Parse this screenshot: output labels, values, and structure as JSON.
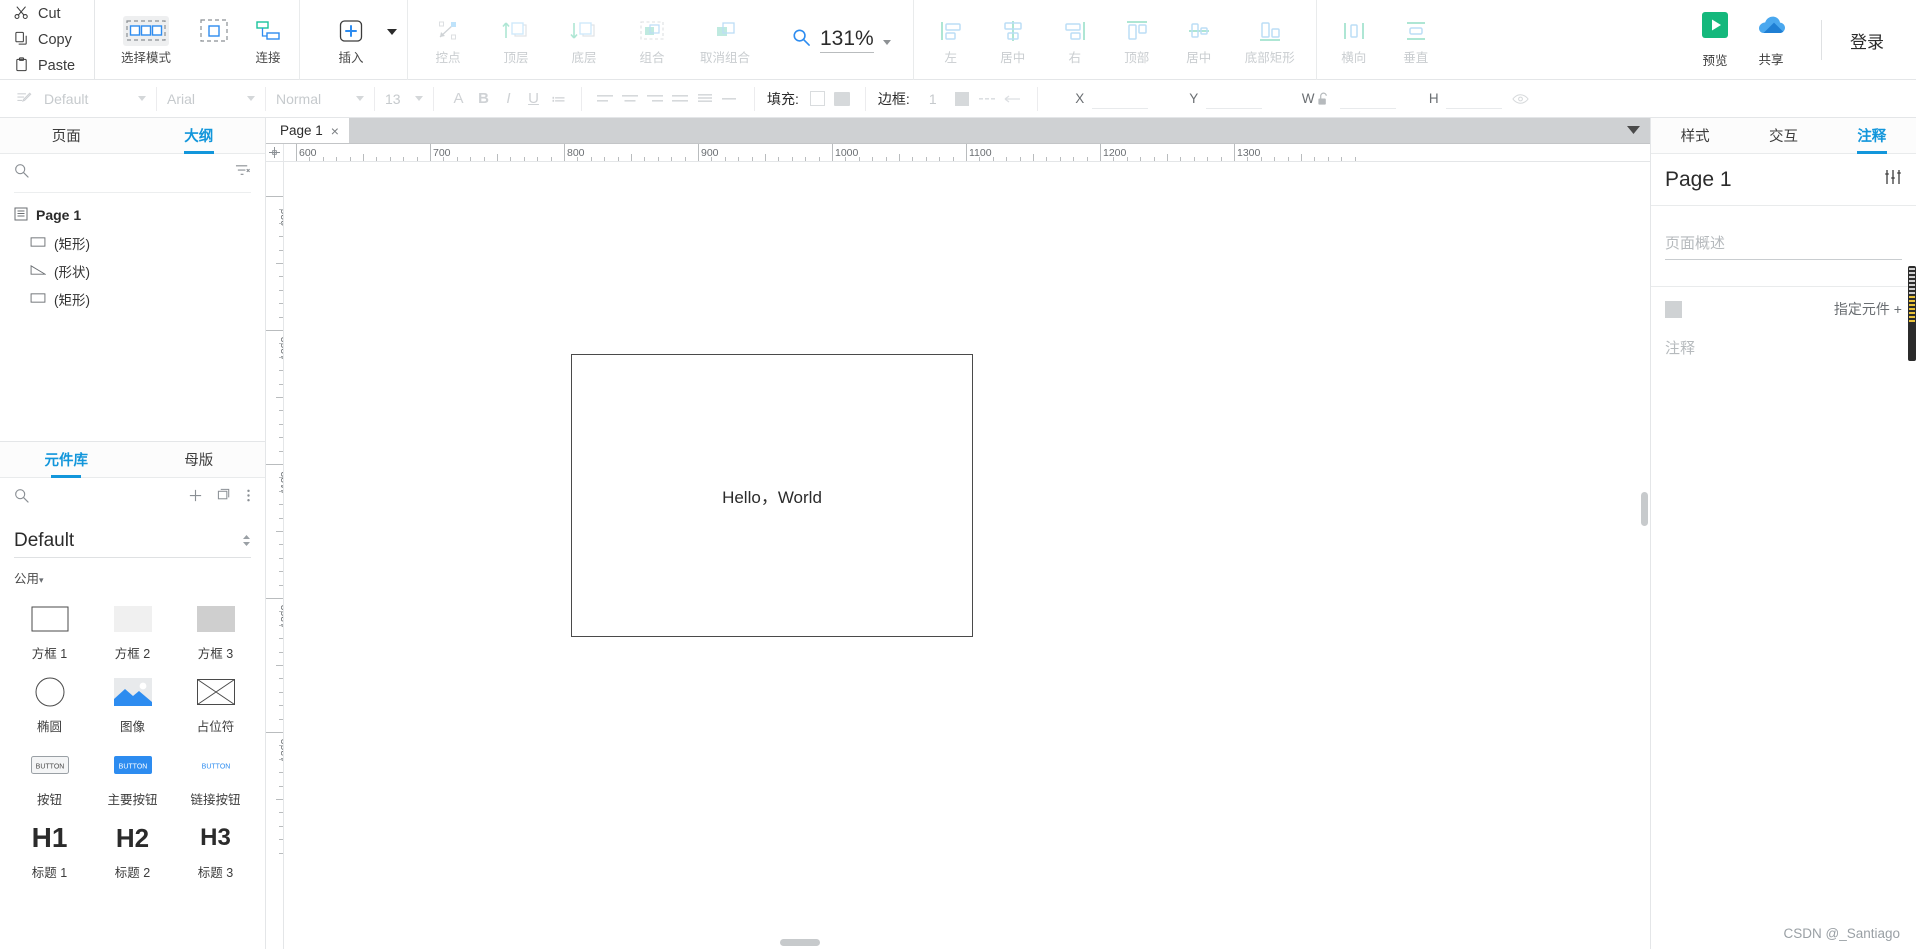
{
  "clipboard": {
    "items": [
      {
        "label": "Cut",
        "icon": "scissors-icon"
      },
      {
        "label": "Copy",
        "icon": "copy-icon"
      },
      {
        "label": "Paste",
        "icon": "clipboard-icon"
      }
    ]
  },
  "toolbar": {
    "mode_group": [
      {
        "label": "选择模式",
        "icon": "select-mode-icon",
        "state": "selected"
      },
      {
        "label": "连接",
        "icon": "connect-icon",
        "state": "enabled"
      }
    ],
    "insert": {
      "label": "插入",
      "icon": "plus-insert-icon"
    },
    "edit_group": [
      {
        "label": "控点",
        "icon": "control-point-icon",
        "state": "disabled"
      },
      {
        "label": "顶层",
        "icon": "bring-to-front-icon",
        "state": "disabled"
      },
      {
        "label": "底层",
        "icon": "send-to-back-icon",
        "state": "disabled"
      },
      {
        "label": "组合",
        "icon": "group-icon",
        "state": "disabled"
      },
      {
        "label": "取消组合",
        "icon": "ungroup-icon",
        "state": "disabled"
      }
    ],
    "zoom": {
      "value": "131%",
      "icon": "magnifier-icon",
      "caret": "chevron-down-icon"
    },
    "align_group": [
      {
        "label": "左",
        "icon": "align-left-icon",
        "state": "disabled"
      },
      {
        "label": "居中",
        "icon": "align-center-horizontal-icon",
        "state": "disabled"
      },
      {
        "label": "右",
        "icon": "align-right-icon",
        "state": "disabled"
      },
      {
        "label": "顶部",
        "icon": "align-top-icon",
        "state": "disabled"
      },
      {
        "label": "居中",
        "icon": "align-middle-vertical-icon",
        "state": "disabled"
      },
      {
        "label": "底部矩形",
        "icon": "align-bottom-icon",
        "state": "disabled"
      }
    ],
    "distribute_group": [
      {
        "label": "横向",
        "icon": "distribute-horizontal-icon",
        "state": "disabled"
      },
      {
        "label": "垂直",
        "icon": "distribute-vertical-icon",
        "state": "disabled"
      }
    ],
    "preview": {
      "label": "预览",
      "icon": "play-icon",
      "color": "#14b87c"
    },
    "share": {
      "label": "共享",
      "icon": "cloud-icon",
      "color": "#2196f3"
    },
    "login": {
      "label": "登录"
    }
  },
  "formatbar": {
    "style_preset": "Default",
    "font_family": "Arial",
    "font_weight": "Normal",
    "font_size": "13",
    "text_icons": [
      {
        "name": "text-color-icon",
        "glyph": "A"
      },
      {
        "name": "bold-icon",
        "glyph": "B"
      },
      {
        "name": "italic-icon",
        "glyph": "I"
      },
      {
        "name": "underline-icon",
        "glyph": "U"
      },
      {
        "name": "bullet-list-icon",
        "glyph": "≔"
      }
    ],
    "fill_label": "填充:",
    "border_label": "边框:",
    "border_width": "1",
    "coords": [
      {
        "label": "X",
        "value": ""
      },
      {
        "label": "Y",
        "value": ""
      },
      {
        "label": "W",
        "value": ""
      },
      {
        "label": "H",
        "value": ""
      }
    ],
    "lock_icon": "lock-open-icon",
    "visibility_icon": "eye-icon"
  },
  "left_panel": {
    "tabs": [
      {
        "label": "页面",
        "active": false
      },
      {
        "label": "大纲",
        "active": true
      }
    ],
    "search_placeholder": "",
    "search_icon": "search-icon",
    "filter_icon": "filter-icon",
    "tree": {
      "root": {
        "label": "Page 1",
        "icon": "page-icon"
      },
      "children": [
        {
          "label": "(矩形)",
          "icon": "rectangle-icon"
        },
        {
          "label": "(形状)",
          "icon": "shape-icon"
        },
        {
          "label": "(矩形)",
          "icon": "rectangle-icon"
        }
      ]
    },
    "library": {
      "tabs": [
        {
          "label": "元件库",
          "active": true
        },
        {
          "label": "母版",
          "active": false
        }
      ],
      "search_icon": "search-icon",
      "add_icon": "plus-icon",
      "duplicate_icon": "copy-library-icon",
      "more_icon": "more-vertical-icon",
      "selected_library": "Default",
      "group_label": "公用",
      "widgets": [
        {
          "label": "方框 1",
          "icon": "box-outline-icon"
        },
        {
          "label": "方框 2",
          "icon": "box-light-icon"
        },
        {
          "label": "方框 3",
          "icon": "box-gray-icon"
        },
        {
          "label": "椭圆",
          "icon": "ellipse-icon"
        },
        {
          "label": "图像",
          "icon": "image-icon"
        },
        {
          "label": "占位符",
          "icon": "placeholder-icon"
        },
        {
          "label": "按钮",
          "icon": "button-icon"
        },
        {
          "label": "主要按钮",
          "icon": "primary-button-icon"
        },
        {
          "label": "链接按钮",
          "icon": "link-button-icon"
        },
        {
          "label": "标题 1",
          "icon": "h1-icon",
          "glyph": "H1"
        },
        {
          "label": "标题 2",
          "icon": "h2-icon",
          "glyph": "H2"
        },
        {
          "label": "标题 3",
          "icon": "h3-icon",
          "glyph": "H3"
        }
      ]
    }
  },
  "canvas": {
    "page_tab": {
      "label": "Page 1",
      "close_icon": "close-icon"
    },
    "tabs_overflow_icon": "chevron-down-icon",
    "h_ruler_labels": [
      "600",
      "700",
      "800",
      "900",
      "1000",
      "1100",
      "1200",
      "1300"
    ],
    "v_ruler_labels": [
      "900",
      "1000",
      "1100",
      "1200",
      "1300"
    ],
    "shapes": [
      {
        "name": "hello-world-rectangle",
        "text": "Hello，World"
      }
    ]
  },
  "right_panel": {
    "tabs": [
      {
        "label": "样式",
        "active": false
      },
      {
        "label": "交互",
        "active": false
      },
      {
        "label": "注释",
        "active": true
      }
    ],
    "title": "Page 1",
    "settings_icon": "sliders-icon",
    "page_summary_placeholder": "页面概述",
    "assign_element_label": "指定元件 +",
    "note_placeholder": "注释"
  },
  "watermark": "CSDN @_Santiago"
}
